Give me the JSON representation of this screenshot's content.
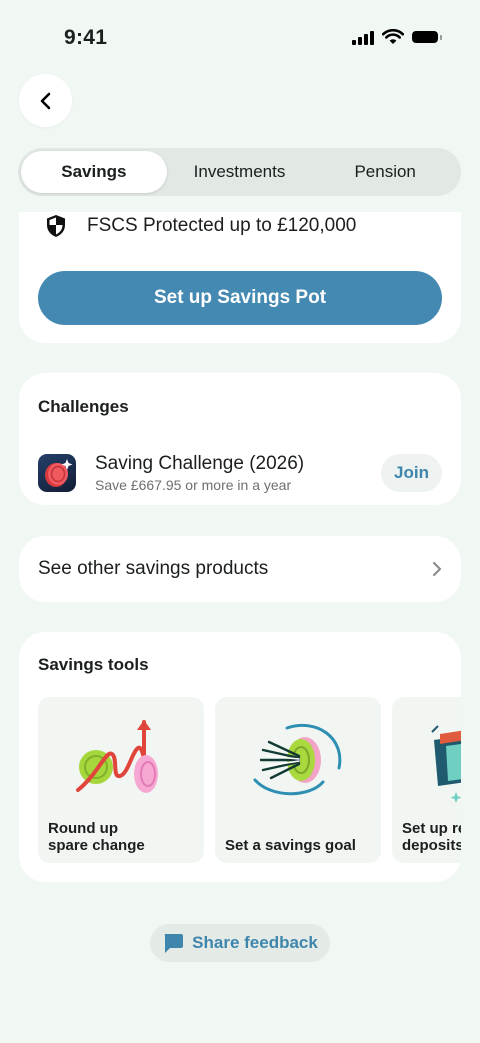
{
  "status_bar": {
    "time": "9:41"
  },
  "nav": {
    "back_icon": "chevron-left-icon"
  },
  "tabs": [
    {
      "label": "Savings",
      "active": true
    },
    {
      "label": "Investments",
      "active": false
    },
    {
      "label": "Pension",
      "active": false
    }
  ],
  "savings_card": {
    "fscs_icon": "shield-icon",
    "fscs_text": "FSCS Protected up to £120,000",
    "primary_button": "Set up Savings Pot"
  },
  "challenges": {
    "title": "Challenges",
    "item": {
      "title": "Saving Challenge (2026)",
      "subtitle": "Save £667.95 or more in a year",
      "action": "Join"
    }
  },
  "other_products": {
    "label": "See other savings products"
  },
  "tools": {
    "title": "Savings tools",
    "items": [
      {
        "label": "Round up\nspare change"
      },
      {
        "label": "Set a savings goal"
      },
      {
        "label": "Set up re\ndeposits"
      }
    ]
  },
  "feedback": {
    "label": "Share feedback",
    "icon": "chat-bubble-icon"
  },
  "colors": {
    "accent": "#4389b1",
    "link": "#3f86ad",
    "background": "#f1f7f3"
  }
}
